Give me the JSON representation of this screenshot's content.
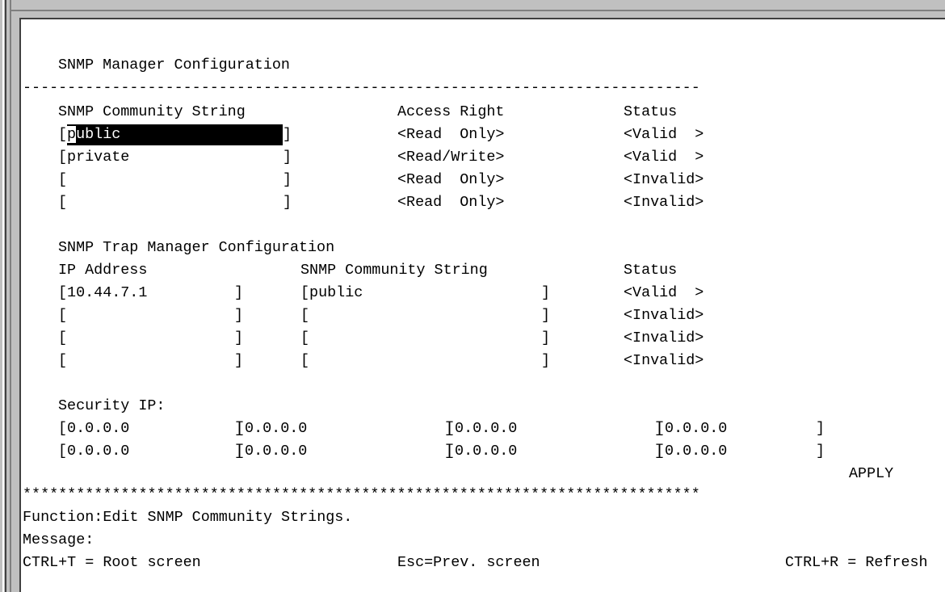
{
  "screen": {
    "title": "SNMP Manager Configuration",
    "dash_rule": "----------------------------------------------------------------------------",
    "star_rule": "****************************************************************************"
  },
  "community": {
    "headers": {
      "string": "SNMP Community String",
      "access": "Access Right",
      "status": "Status"
    },
    "rows": [
      {
        "string": "public",
        "access": "<Read  Only>",
        "status": "<Valid  >"
      },
      {
        "string": "private",
        "access": "<Read/Write>",
        "status": "<Valid  >"
      },
      {
        "string": "",
        "access": "<Read  Only>",
        "status": "<Invalid>"
      },
      {
        "string": "",
        "access": "<Read  Only>",
        "status": "<Invalid>"
      }
    ]
  },
  "trap": {
    "title": "SNMP Trap Manager Configuration",
    "headers": {
      "ip": "IP Address",
      "string": "SNMP Community String",
      "status": "Status"
    },
    "rows": [
      {
        "ip": "10.44.7.1",
        "string": "public",
        "status": "<Valid  >"
      },
      {
        "ip": "",
        "string": "",
        "status": "<Invalid>"
      },
      {
        "ip": "",
        "string": "",
        "status": "<Invalid>"
      },
      {
        "ip": "",
        "string": "",
        "status": "<Invalid>"
      }
    ]
  },
  "security": {
    "label": "Security IP:",
    "rows": [
      [
        "0.0.0.0",
        "0.0.0.0",
        "0.0.0.0",
        "0.0.0.0"
      ],
      [
        "0.0.0.0",
        "0.0.0.0",
        "0.0.0.0",
        "0.0.0.0"
      ]
    ]
  },
  "apply_label": "APPLY",
  "footer": {
    "function": "Function:Edit SNMP Community Strings.",
    "message": "Message:",
    "keys": {
      "root": "CTRL+T = Root screen",
      "prev": "Esc=Prev. screen",
      "refresh": "CTRL+R = Refresh"
    }
  }
}
